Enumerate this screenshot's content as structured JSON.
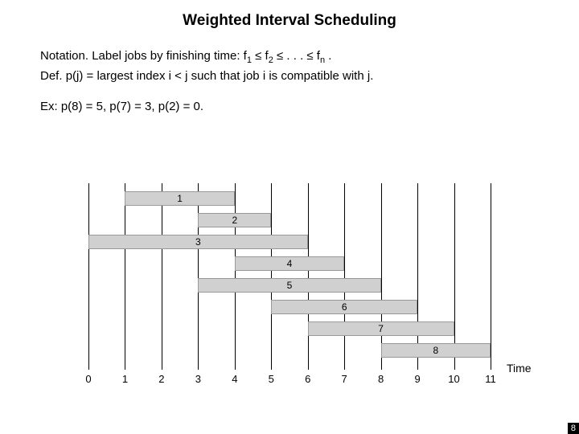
{
  "title": "Weighted Interval Scheduling",
  "notation_label": "Notation.",
  "notation_text_a": "Label jobs by finishing time:  f",
  "notation_sub1": "1",
  "notation_le1": " ≤ f",
  "notation_sub2": "2",
  "notation_le2": " ≤ . . . ≤ f",
  "notation_subn": "n",
  "notation_end": " .",
  "def_label": "Def.",
  "def_text": "p(j) = largest index i < j such that job i is compatible with j.",
  "ex_text": "Ex:  p(8) = 5, p(7) = 3, p(2) = 0.",
  "axis_label": "Time",
  "page_number": "8",
  "chart_data": {
    "type": "bar",
    "title": "",
    "xlabel": "Time",
    "ylabel": "",
    "xlim": [
      0,
      11
    ],
    "ticks": [
      "0",
      "1",
      "2",
      "3",
      "4",
      "5",
      "6",
      "7",
      "8",
      "9",
      "10",
      "11"
    ],
    "intervals": [
      {
        "label": "1",
        "start": 1,
        "end": 4
      },
      {
        "label": "2",
        "start": 3,
        "end": 5
      },
      {
        "label": "3",
        "start": 0,
        "end": 6
      },
      {
        "label": "4",
        "start": 4,
        "end": 7
      },
      {
        "label": "5",
        "start": 3,
        "end": 8
      },
      {
        "label": "6",
        "start": 5,
        "end": 9
      },
      {
        "label": "7",
        "start": 6,
        "end": 10
      },
      {
        "label": "8",
        "start": 8,
        "end": 11
      }
    ]
  }
}
